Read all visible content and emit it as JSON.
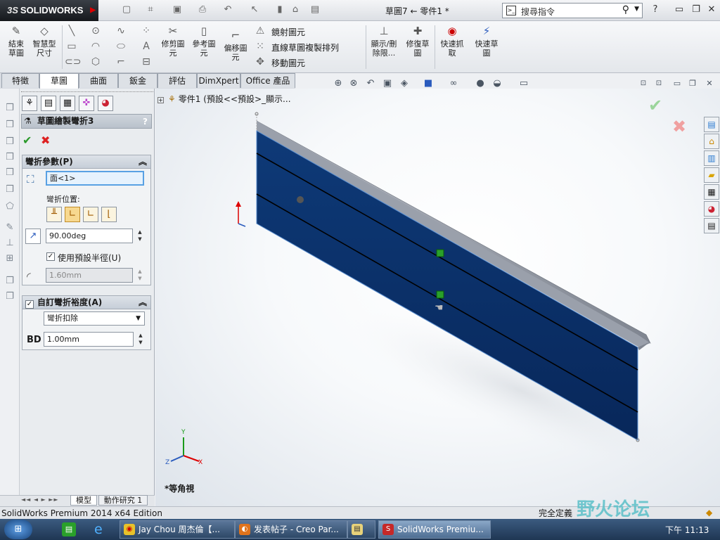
{
  "app": {
    "brand": "SOLIDWORKS",
    "brand_prefix": "3S",
    "doc_title": "草圖7 ← 零件1 *"
  },
  "search": {
    "placeholder": "搜尋指令"
  },
  "cmd": {
    "exit_sketch": "結束\n草圖",
    "smart_dim": "智慧型\n尺寸",
    "trim": "修剪圖\n元",
    "ref_geo": "參考圖\n元",
    "offset": "偏移圖\n元",
    "mirror": "鏡射圖元",
    "linear_pattern": "直線草圖複製排列",
    "move": "移動圖元",
    "display_delete": "顯示/刪\n除限...",
    "repair": "修復草\n圖",
    "quick_snap": "快速抓\n取",
    "rapid_sketch": "快速草\n圖"
  },
  "tabs": [
    "特徵",
    "草圖",
    "曲面",
    "鈑金",
    "評估",
    "DimXpert",
    "Office 產品"
  ],
  "pm": {
    "title": "草圖繪製彎折3",
    "group1": "彎折參數(P)",
    "face": "面<1>",
    "bend_pos_label": "彎折位置:",
    "angle": "90.00deg",
    "use_default_radius": "使用預設半徑(U)",
    "radius": "1.60mm",
    "group2": "自訂彎折裕度(A)",
    "allowance_type": "彎折扣除",
    "bd_label": "BD",
    "bd_value": "1.00mm"
  },
  "tree": {
    "node": "零件1 (預設<<預設>_顯示..."
  },
  "view": {
    "name": "*等角視"
  },
  "bottom_tabs": [
    "模型",
    "動作研究 1"
  ],
  "status": {
    "left": "SolidWorks Premium 2014 x64 Edition",
    "right": "完全定義"
  },
  "taskbar": {
    "items": [
      "Jay Chou 周杰倫【...",
      "发表帖子 - Creo Par...",
      "",
      "SolidWorks Premiu..."
    ],
    "clock": "下午 11:13"
  },
  "watermark": "野火论坛",
  "axes": {
    "x": "X",
    "y": "Y",
    "z": "Z"
  }
}
